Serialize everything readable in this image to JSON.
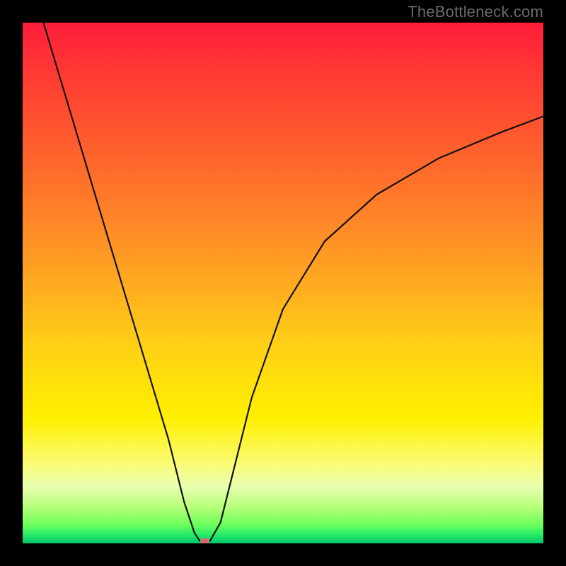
{
  "watermark": "TheBottleneck.com",
  "chart_data": {
    "type": "line",
    "title": "",
    "xlabel": "",
    "ylabel": "",
    "xlim": [
      0,
      100
    ],
    "ylim": [
      0,
      100
    ],
    "note": "V-shaped bottleneck curve overlaid on a vertical red-to-green gradient. Values are percentages on both axes. Left branch is near-linear and steep; right branch is concave and asymptotically rises.",
    "series": [
      {
        "name": "bottleneck-curve",
        "x": [
          4,
          10,
          16,
          22,
          28,
          31,
          33,
          34,
          35,
          36,
          38,
          40,
          44,
          50,
          58,
          68,
          80,
          92,
          100
        ],
        "y": [
          100,
          80,
          60,
          40,
          20,
          8,
          2,
          0.5,
          0,
          0.5,
          4,
          12,
          28,
          45,
          58,
          67,
          74,
          79,
          82
        ]
      }
    ],
    "vertex": {
      "x": 35,
      "y": 0
    },
    "background_gradient": {
      "top": "#ff1d3a",
      "mid": "#fff000",
      "bottom": "#00c46b"
    }
  }
}
